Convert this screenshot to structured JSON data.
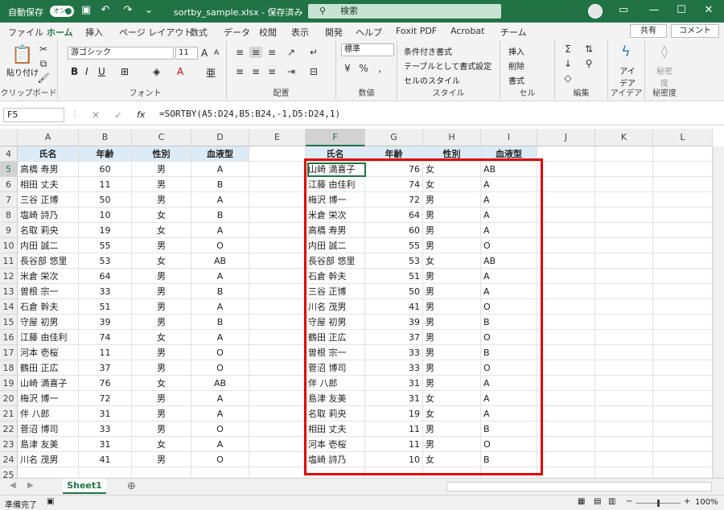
{
  "titlebar": {
    "autosave": "自動保存",
    "toggle": "オン",
    "filename": "sortby_sample.xlsx - 保存済み",
    "search": "検索"
  },
  "tabs": [
    "ファイル",
    "ホーム",
    "挿入",
    "ページ レイアウト",
    "数式",
    "データ",
    "校閲",
    "表示",
    "開発",
    "ヘルプ",
    "Foxit PDF",
    "Acrobat",
    "チーム"
  ],
  "share": "共有",
  "comment": "コメント",
  "ribbon": {
    "clipboard": {
      "paste": "貼り付け",
      "label": "クリップボード"
    },
    "font": {
      "name": "游ゴシック",
      "size": "11",
      "label": "フォント"
    },
    "align": {
      "label": "配置"
    },
    "number": {
      "format": "標準",
      "label": "数値"
    },
    "style": {
      "cond": "条件付き書式",
      "table": "テーブルとして書式設定",
      "cell": "セルのスタイル",
      "label": "スタイル"
    },
    "cells": {
      "insert": "挿入",
      "delete": "削除",
      "format": "書式",
      "label": "セル"
    },
    "edit": {
      "label": "編集"
    },
    "idea": {
      "btn": "アイデア",
      "label": "アイデア"
    },
    "sens": {
      "btn": "秘密度",
      "label": "秘密度"
    }
  },
  "namebox": "F5",
  "formula": "=SORTBY(A5:D24,B5:B24,-1,D5:D24,1)",
  "columns": [
    "A",
    "B",
    "C",
    "D",
    "E",
    "F",
    "G",
    "H",
    "I",
    "J",
    "K",
    "L"
  ],
  "rows": [
    "4",
    "5",
    "6",
    "7",
    "8",
    "9",
    "10",
    "11",
    "12",
    "13",
    "14",
    "15",
    "16",
    "17",
    "18",
    "19",
    "20",
    "21",
    "22",
    "23",
    "24",
    "25"
  ],
  "headers": [
    "氏名",
    "年齢",
    "性別",
    "血液型"
  ],
  "source": [
    [
      "高橋 寿男",
      "60",
      "男",
      "A"
    ],
    [
      "相田 丈夫",
      "11",
      "男",
      "B"
    ],
    [
      "三谷 正博",
      "50",
      "男",
      "A"
    ],
    [
      "塩崎 詩乃",
      "10",
      "女",
      "B"
    ],
    [
      "名取 莉央",
      "19",
      "女",
      "A"
    ],
    [
      "内田 誠二",
      "55",
      "男",
      "O"
    ],
    [
      "長谷部 悠里",
      "53",
      "女",
      "AB"
    ],
    [
      "米倉 栄次",
      "64",
      "男",
      "A"
    ],
    [
      "曽根 宗一",
      "33",
      "男",
      "B"
    ],
    [
      "石倉 幹夫",
      "51",
      "男",
      "A"
    ],
    [
      "守屋 初男",
      "39",
      "男",
      "B"
    ],
    [
      "江藤 由佳利",
      "74",
      "女",
      "A"
    ],
    [
      "河本 壱桜",
      "11",
      "男",
      "O"
    ],
    [
      "鶴田 正広",
      "37",
      "男",
      "O"
    ],
    [
      "山崎 満喜子",
      "76",
      "女",
      "AB"
    ],
    [
      "梅沢 博一",
      "72",
      "男",
      "A"
    ],
    [
      "伴 八郎",
      "31",
      "男",
      "A"
    ],
    [
      "菅沼 博司",
      "33",
      "男",
      "O"
    ],
    [
      "島津 友美",
      "31",
      "女",
      "A"
    ],
    [
      "川名 茂男",
      "41",
      "男",
      "O"
    ]
  ],
  "sorted": [
    [
      "山崎 満喜子",
      "76",
      "女",
      "AB"
    ],
    [
      "江藤 由佳利",
      "74",
      "女",
      "A"
    ],
    [
      "梅沢 博一",
      "72",
      "男",
      "A"
    ],
    [
      "米倉 栄次",
      "64",
      "男",
      "A"
    ],
    [
      "高橋 寿男",
      "60",
      "男",
      "A"
    ],
    [
      "内田 誠二",
      "55",
      "男",
      "O"
    ],
    [
      "長谷部 悠里",
      "53",
      "女",
      "AB"
    ],
    [
      "石倉 幹夫",
      "51",
      "男",
      "A"
    ],
    [
      "三谷 正博",
      "50",
      "男",
      "A"
    ],
    [
      "川名 茂男",
      "41",
      "男",
      "O"
    ],
    [
      "守屋 初男",
      "39",
      "男",
      "B"
    ],
    [
      "鶴田 正広",
      "37",
      "男",
      "O"
    ],
    [
      "曽根 宗一",
      "33",
      "男",
      "B"
    ],
    [
      "菅沼 博司",
      "33",
      "男",
      "O"
    ],
    [
      "伴 八郎",
      "31",
      "男",
      "A"
    ],
    [
      "島津 友美",
      "31",
      "女",
      "A"
    ],
    [
      "名取 莉央",
      "19",
      "女",
      "A"
    ],
    [
      "相田 丈夫",
      "11",
      "男",
      "B"
    ],
    [
      "河本 壱桜",
      "11",
      "男",
      "O"
    ],
    [
      "塩崎 詩乃",
      "10",
      "女",
      "B"
    ]
  ],
  "sheet": "Sheet1",
  "status": {
    "ready": "準備完了",
    "zoom": "100%"
  }
}
